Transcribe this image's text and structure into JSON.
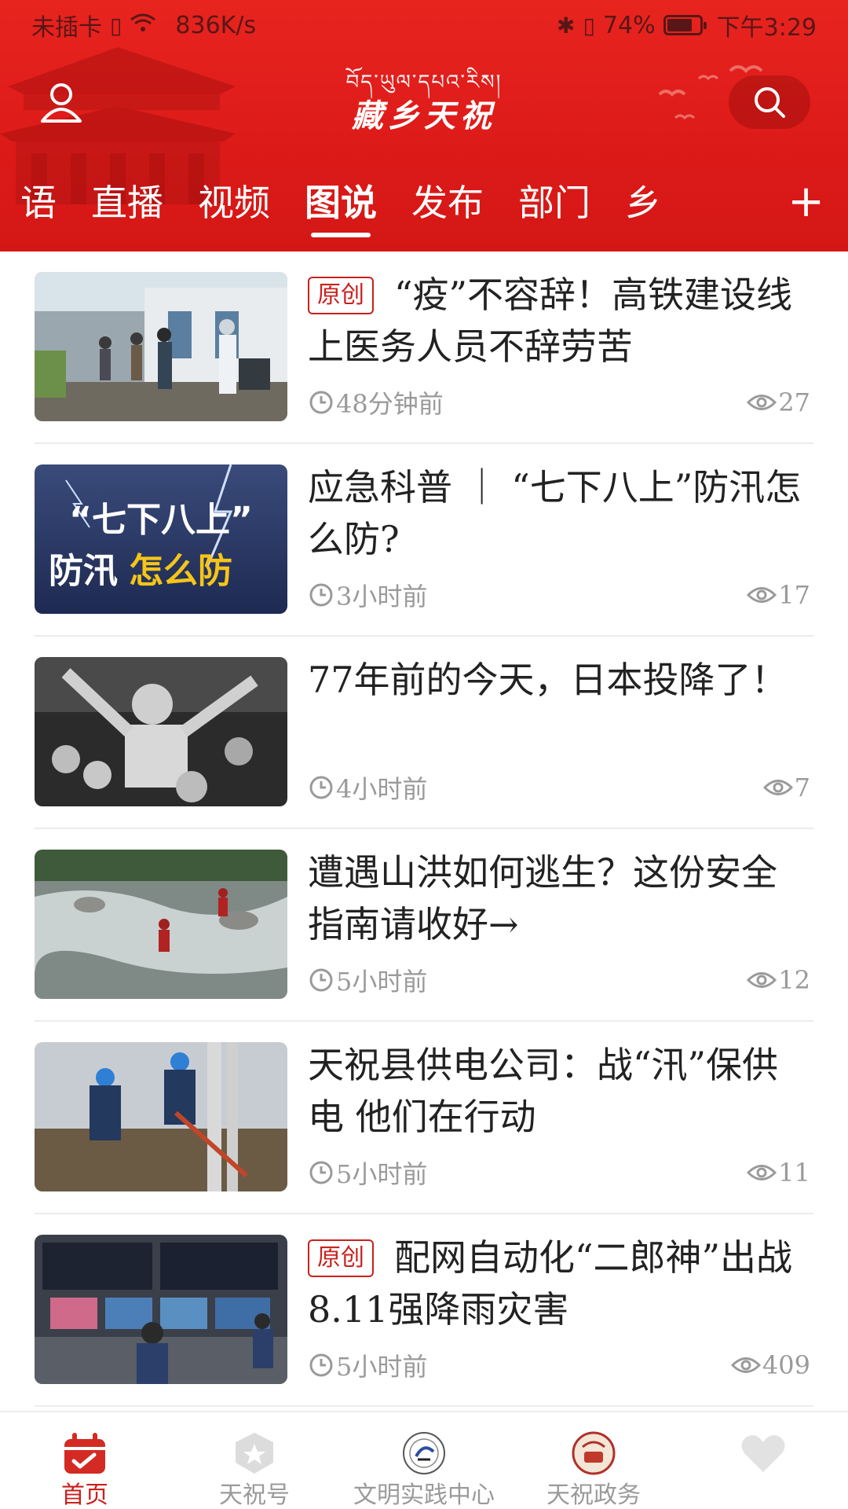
{
  "status_bar": {
    "carrier": "未插卡",
    "net_speed": "836K/s",
    "battery_percent": "74%",
    "battery_level": 0.74,
    "time": "下午3:29"
  },
  "header": {
    "logo_tibetan": "བོད་ཡུལ་དཔའ་རིས།",
    "logo_title": "藏乡天祝",
    "tabs": [
      "语",
      "直播",
      "视频",
      "图说",
      "发布",
      "部门",
      "乡"
    ],
    "active_tab": "图说",
    "add_label": "+"
  },
  "articles": [
    {
      "tag": "原创",
      "title": "“疫”不容辞！高铁建设线上医务人员不辞劳苦",
      "time": "48分钟前",
      "views": "27",
      "thumb": "medical-workers-photo"
    },
    {
      "tag": "",
      "title": "应急科普 ｜ “七下八上”防汛怎么防?",
      "time": "3小时前",
      "views": "17",
      "thumb": "flood-prevention-graphic"
    },
    {
      "tag": "",
      "title": "77年前的今天，日本投降了！",
      "time": "4小时前",
      "views": "7",
      "thumb": "historic-celebration-photo"
    },
    {
      "tag": "",
      "title": "遭遇山洪如何逃生？这份安全指南请收好→",
      "time": "5小时前",
      "views": "12",
      "thumb": "mountain-flood-photo"
    },
    {
      "tag": "",
      "title": "天祝县供电公司：战“汛”保供电 他们在行动",
      "time": "5小时前",
      "views": "11",
      "thumb": "power-workers-photo"
    },
    {
      "tag": "原创",
      "title": "配网自动化“二郎神”出战8.11强降雨灾害",
      "time": "5小时前",
      "views": "409",
      "thumb": "control-room-photo"
    }
  ],
  "thumb2_text": {
    "line1": "“七下八上”",
    "line2a": "防汛",
    "line2b": "怎么防"
  },
  "bottom_nav": [
    {
      "label": "首页",
      "icon": "calendar-check-icon",
      "active": true
    },
    {
      "label": "天祝号",
      "icon": "star-badge-icon",
      "active": false
    },
    {
      "label": "文明实践中心",
      "icon": "emblem-icon",
      "active": false
    },
    {
      "label": "天祝政务",
      "icon": "seal-icon",
      "active": false
    },
    {
      "label": "",
      "icon": "heart-icon",
      "active": false
    }
  ],
  "colors": {
    "brand_red": "#dd1b19",
    "tag_red": "#c9211e",
    "meta_gray": "#9a9a9a"
  }
}
